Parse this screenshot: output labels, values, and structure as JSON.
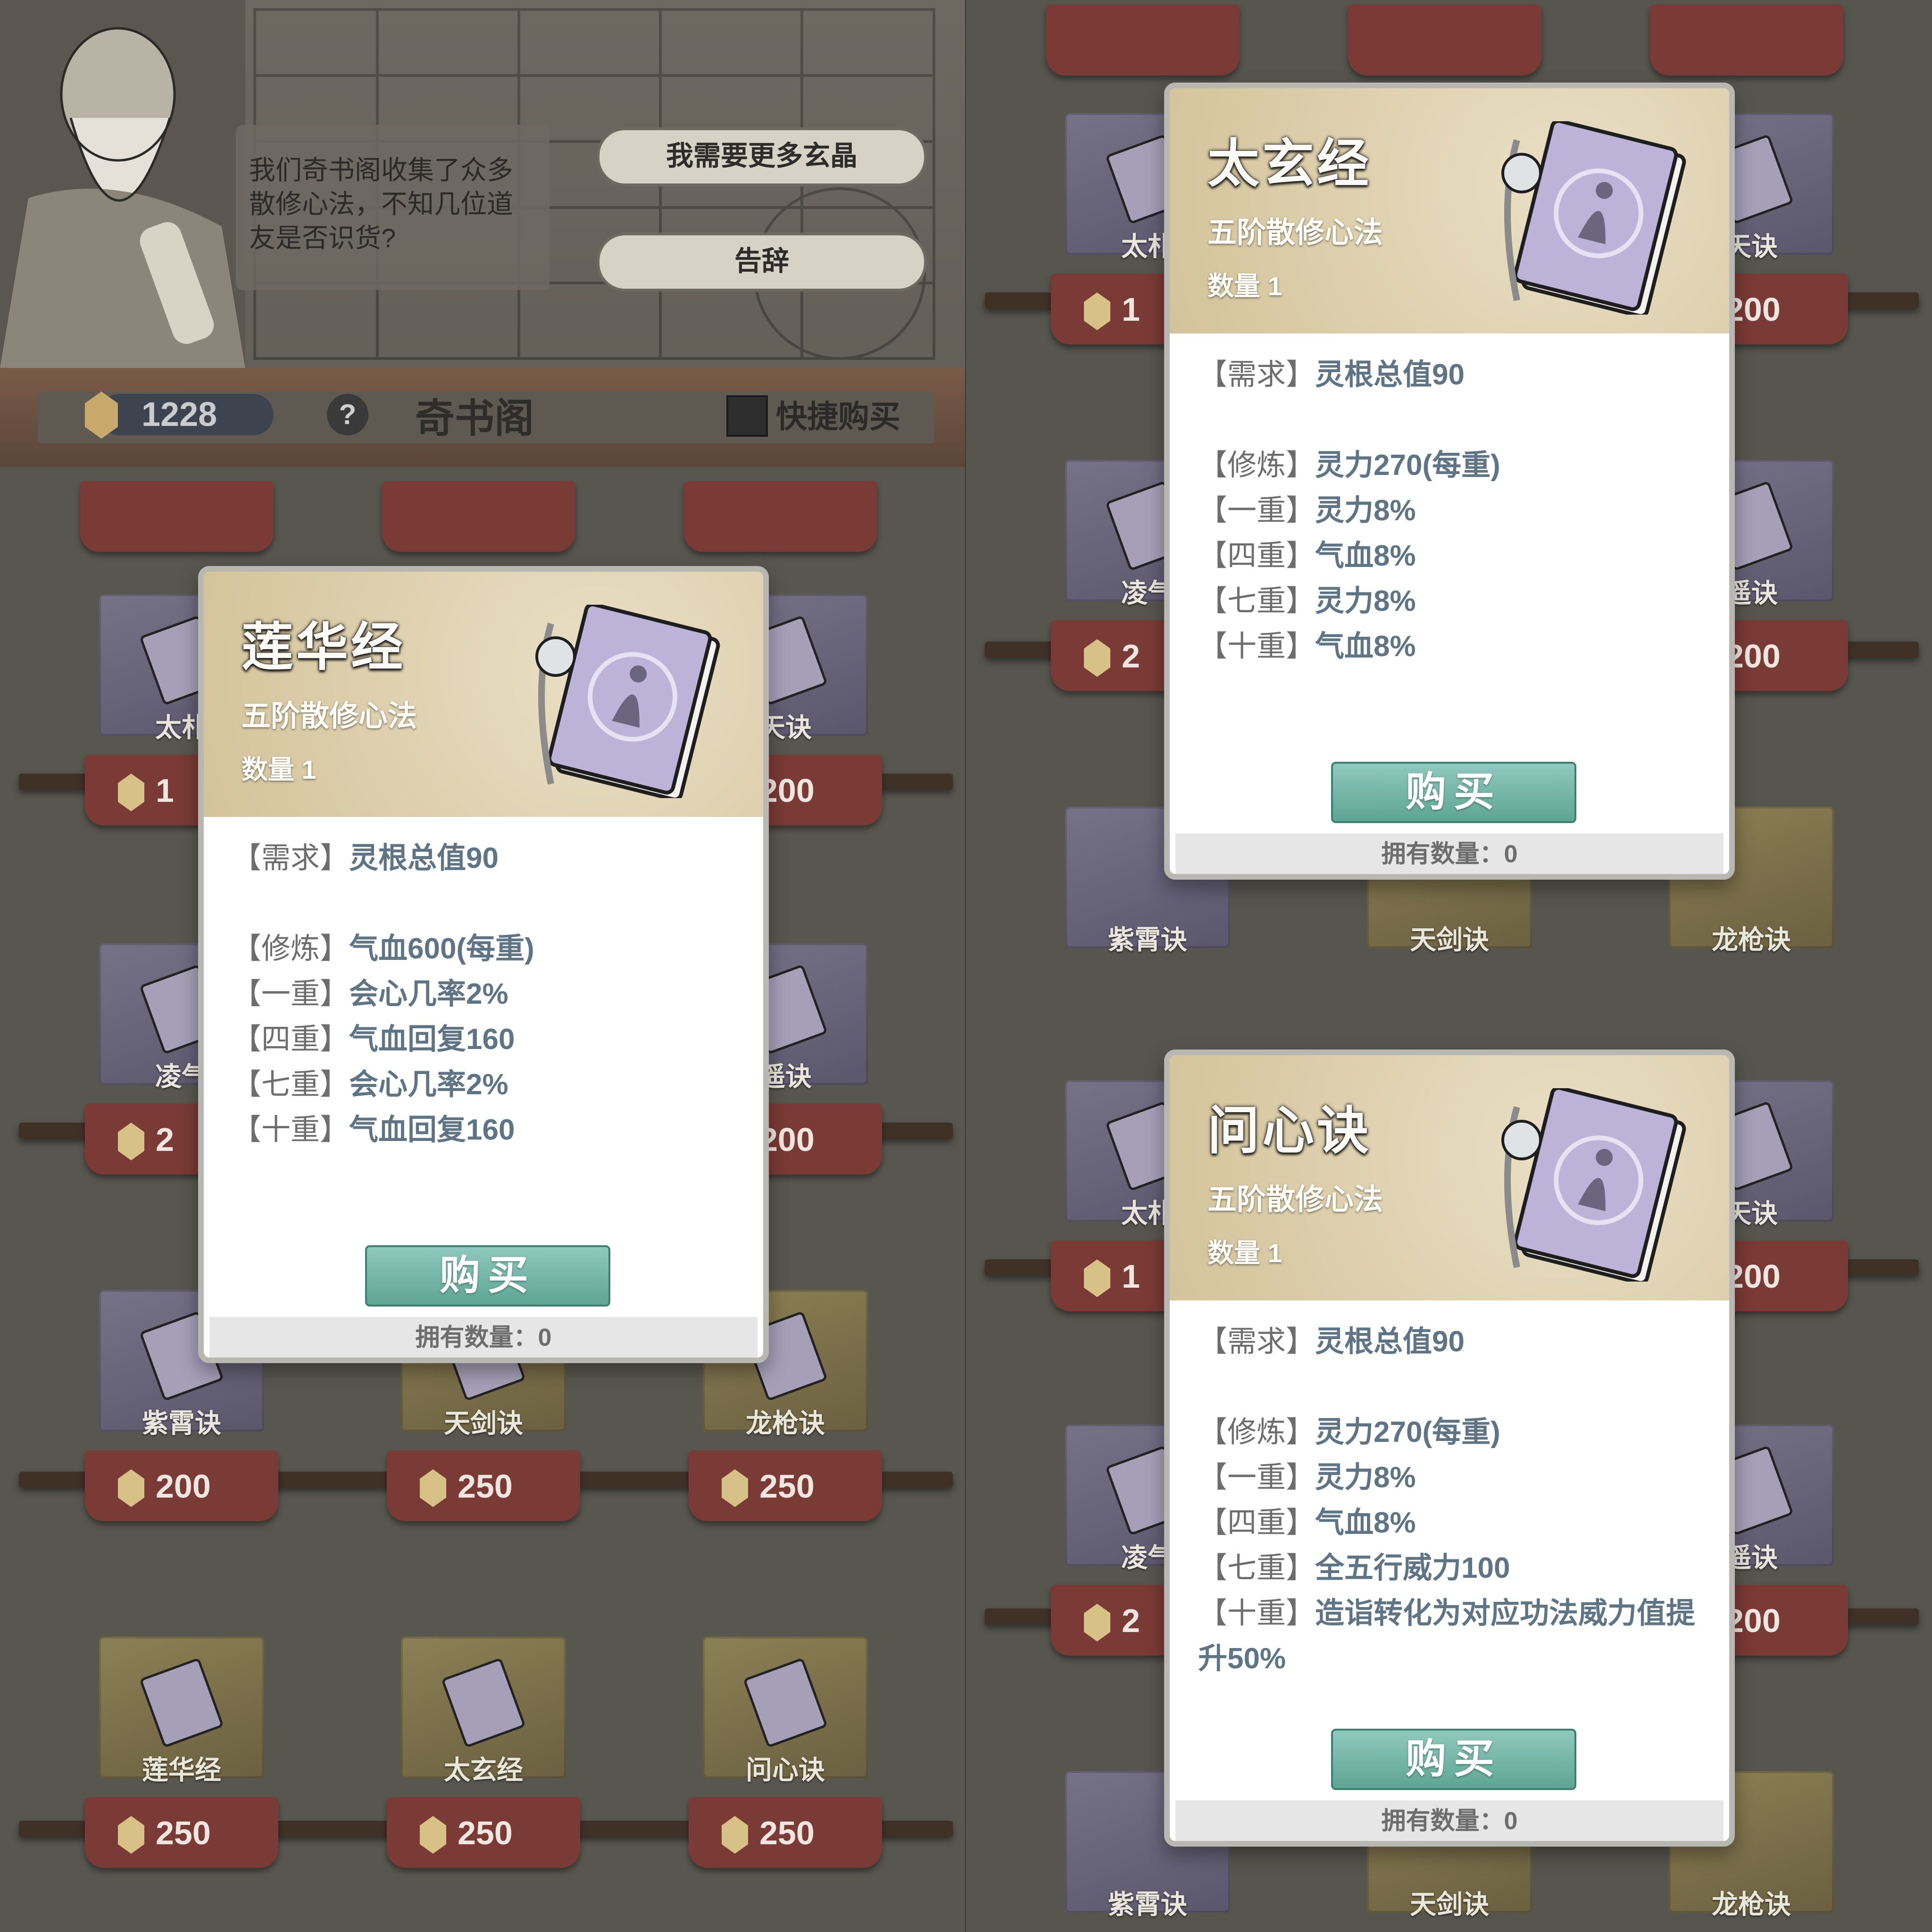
{
  "header": {
    "npc_dialog": "我们奇书阁收集了众多散修心法，不知几位道友是否识货?",
    "option_more": "我需要更多玄晶",
    "option_leave": "告辞",
    "currency": "1228",
    "help": "?",
    "shop_title": "奇书阁",
    "quick_buy": "快捷购买"
  },
  "left_grid": [
    {
      "name": "太朴",
      "price": "1"
    },
    {
      "name": "天诀",
      "price": "200"
    },
    {
      "name": "凌气",
      "price": "2"
    },
    {
      "name": "遥诀",
      "price": "200"
    },
    {
      "name": "紫霄诀",
      "price": "200"
    },
    {
      "name": "天剑诀",
      "price": "250"
    },
    {
      "name": "龙枪诀",
      "price": "250"
    },
    {
      "name": "莲华经",
      "price": "250"
    },
    {
      "name": "太玄经",
      "price": "250"
    },
    {
      "name": "问心诀",
      "price": "250"
    }
  ],
  "right_grid": [
    {
      "name": "太朴",
      "price": "1"
    },
    {
      "name": "天诀",
      "price": "200"
    },
    {
      "name": "凌气",
      "price": "2"
    },
    {
      "name": "遥诀",
      "price": "200"
    },
    {
      "name": "紫霄诀",
      "price": ""
    },
    {
      "name": "天剑诀",
      "price": ""
    },
    {
      "name": "龙枪诀",
      "price": ""
    },
    {
      "name": "太朴",
      "price": "1"
    },
    {
      "name": "天诀",
      "price": "200"
    },
    {
      "name": "凌气",
      "price": "2"
    },
    {
      "name": "遥诀",
      "price": "200"
    },
    {
      "name": "紫霄诀",
      "price": ""
    },
    {
      "name": "天剑诀",
      "price": ""
    },
    {
      "name": "龙枪诀",
      "price": ""
    }
  ],
  "cards": [
    {
      "title": "莲华经",
      "tier": "五阶散修心法",
      "qty": "数量 1",
      "require_tag": "【需求】",
      "require": "灵根总值90",
      "rows": [
        {
          "tag": "【修炼】",
          "text": "气血600(每重)"
        },
        {
          "tag": "【一重】",
          "text": "会心几率2%"
        },
        {
          "tag": "【四重】",
          "text": "气血回复160"
        },
        {
          "tag": "【七重】",
          "text": "会心几率2%"
        },
        {
          "tag": "【十重】",
          "text": "气血回复160"
        }
      ],
      "buy": "购买",
      "owned": "拥有数量：0"
    },
    {
      "title": "太玄经",
      "tier": "五阶散修心法",
      "qty": "数量 1",
      "require_tag": "【需求】",
      "require": "灵根总值90",
      "rows": [
        {
          "tag": "【修炼】",
          "text": "灵力270(每重)"
        },
        {
          "tag": "【一重】",
          "text": "灵力8%"
        },
        {
          "tag": "【四重】",
          "text": "气血8%"
        },
        {
          "tag": "【七重】",
          "text": "灵力8%"
        },
        {
          "tag": "【十重】",
          "text": "气血8%"
        }
      ],
      "buy": "购买",
      "owned": "拥有数量：0"
    },
    {
      "title": "问心诀",
      "tier": "五阶散修心法",
      "qty": "数量 1",
      "require_tag": "【需求】",
      "require": "灵根总值90",
      "rows": [
        {
          "tag": "【修炼】",
          "text": "灵力270(每重)"
        },
        {
          "tag": "【一重】",
          "text": "灵力8%"
        },
        {
          "tag": "【四重】",
          "text": "气血8%"
        },
        {
          "tag": "【七重】",
          "text": "全五行威力100"
        },
        {
          "tag": "【十重】",
          "text": "造诣转化为对应功法威力值提升50%"
        }
      ],
      "buy": "购买",
      "owned": "拥有数量：0"
    }
  ],
  "colors": {
    "accent": "#5ea593",
    "price_tag": "#7a3a35",
    "effect_text": "#5f7585"
  }
}
